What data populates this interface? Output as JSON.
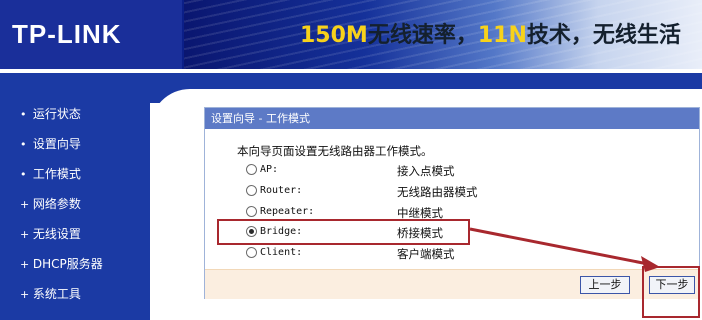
{
  "header": {
    "logo": "TP-LINK",
    "slogan": {
      "part1": "150M",
      "part2": "无线速率，",
      "part3": "11N",
      "part4": "技术，无线生活"
    }
  },
  "sidebar": {
    "items": [
      {
        "bullet": "•",
        "label": "运行状态"
      },
      {
        "bullet": "•",
        "label": "设置向导"
      },
      {
        "bullet": "•",
        "label": "工作模式"
      },
      {
        "bullet": "+",
        "label": "网络参数"
      },
      {
        "bullet": "+",
        "label": "无线设置"
      },
      {
        "bullet": "+",
        "label": "DHCP服务器"
      },
      {
        "bullet": "+",
        "label": "系统工具"
      }
    ]
  },
  "panel": {
    "title": "设置向导 - 工作模式",
    "description": "本向导页面设置无线路由器工作模式。",
    "modes": [
      {
        "name": "AP:",
        "desc": "接入点模式",
        "selected": false
      },
      {
        "name": "Router:",
        "desc": "无线路由器模式",
        "selected": false
      },
      {
        "name": "Repeater:",
        "desc": "中继模式",
        "selected": false
      },
      {
        "name": "Bridge:",
        "desc": "桥接模式",
        "selected": true
      },
      {
        "name": "Client:",
        "desc": "客户端模式",
        "selected": false
      }
    ],
    "buttons": {
      "prev": "上一步",
      "next": "下一步"
    }
  },
  "colors": {
    "header": "#0b1f88",
    "sidebar": "#1b3aa4",
    "panel_title": "#5d7ac6",
    "button_strip": "#fbeee0",
    "annotation": "#a8282e"
  }
}
